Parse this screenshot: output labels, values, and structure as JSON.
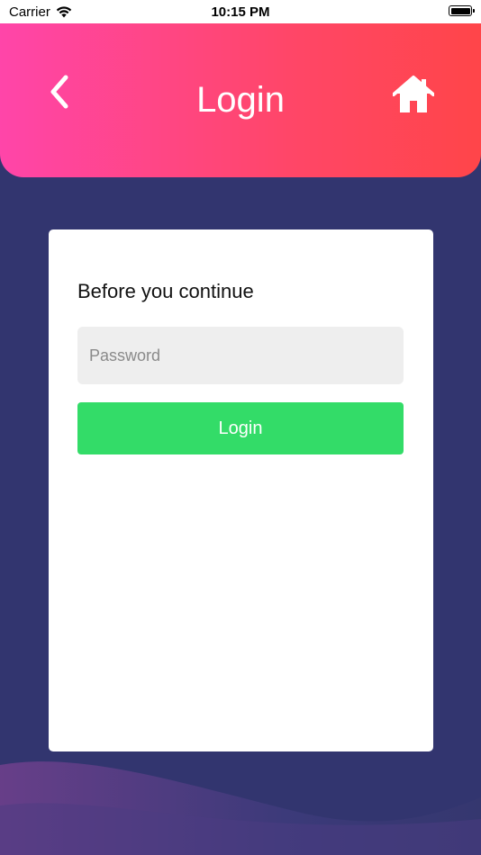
{
  "status_bar": {
    "carrier": "Carrier",
    "time": "10:15 PM",
    "icons": [
      "wifi-icon",
      "battery-icon"
    ]
  },
  "header": {
    "title": "Login",
    "back_icon": "chevron-left-icon",
    "home_icon": "home-icon",
    "gradient": [
      "#ff45a9",
      "#ff4549"
    ]
  },
  "card": {
    "heading": "Before you continue",
    "password": {
      "placeholder": "Password",
      "value": ""
    },
    "login_label": "Login"
  },
  "colors": {
    "background": "#32356f",
    "login_button": "#33dc68",
    "input_background": "#eeeeee"
  }
}
